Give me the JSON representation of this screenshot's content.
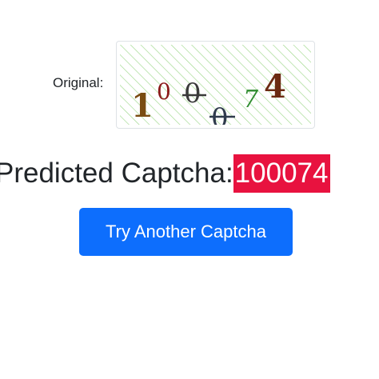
{
  "original": {
    "label": "Original:",
    "captcha": {
      "characters": [
        "1",
        "0",
        "0",
        "0",
        "7",
        "4"
      ],
      "colors": [
        "#7a4c12",
        "#8b1a1a",
        "#3a3a3a",
        "#2f3b4c",
        "#2e8b2e",
        "#6b2a12"
      ],
      "background_pattern": "diagonal-stripes",
      "pattern_color": "#9fd88c"
    }
  },
  "prediction": {
    "label": "Predicted Captcha:",
    "value": "100074",
    "highlight_color": "#e8123f"
  },
  "actions": {
    "try_another_label": "Try Another Captcha",
    "button_color": "#0d6efd"
  }
}
